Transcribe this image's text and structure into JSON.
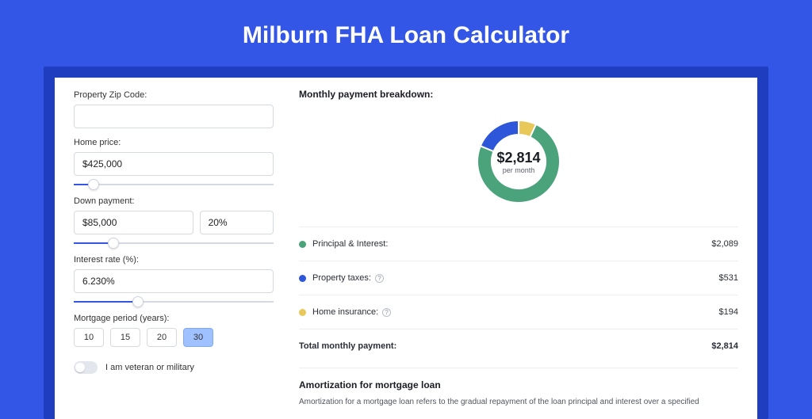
{
  "pageTitle": "Milburn FHA Loan Calculator",
  "form": {
    "zip": {
      "label": "Property Zip Code:",
      "value": ""
    },
    "homePrice": {
      "label": "Home price:",
      "value": "$425,000",
      "sliderPct": 10
    },
    "downPayment": {
      "label": "Down payment:",
      "amount": "$85,000",
      "percent": "20%",
      "sliderPct": 20
    },
    "interest": {
      "label": "Interest rate (%):",
      "value": "6.230%",
      "sliderPct": 32
    },
    "period": {
      "label": "Mortgage period (years):",
      "options": [
        "10",
        "15",
        "20",
        "30"
      ],
      "selected": "30"
    },
    "veteran": {
      "label": "I am veteran or military",
      "value": false
    }
  },
  "breakdown": {
    "title": "Monthly payment breakdown:",
    "centerValue": "$2,814",
    "centerLabel": "per month",
    "rows": [
      {
        "color": "g",
        "label": "Principal & Interest:",
        "value": "$2,089",
        "info": false
      },
      {
        "color": "b",
        "label": "Property taxes:",
        "value": "$531",
        "info": true
      },
      {
        "color": "y",
        "label": "Home insurance:",
        "value": "$194",
        "info": true
      }
    ],
    "totalLabel": "Total monthly payment:",
    "totalValue": "$2,814"
  },
  "amort": {
    "title": "Amortization for mortgage loan",
    "text": "Amortization for a mortgage loan refers to the gradual repayment of the loan principal and interest over a specified"
  },
  "chart_data": {
    "type": "pie",
    "title": "Monthly payment breakdown",
    "series": [
      {
        "name": "Principal & Interest",
        "value": 2089,
        "color": "#4aa37a"
      },
      {
        "name": "Property taxes",
        "value": 531,
        "color": "#2e56d8"
      },
      {
        "name": "Home insurance",
        "value": 194,
        "color": "#e9c85a"
      }
    ],
    "total": 2814,
    "centerLabel": "per month"
  }
}
